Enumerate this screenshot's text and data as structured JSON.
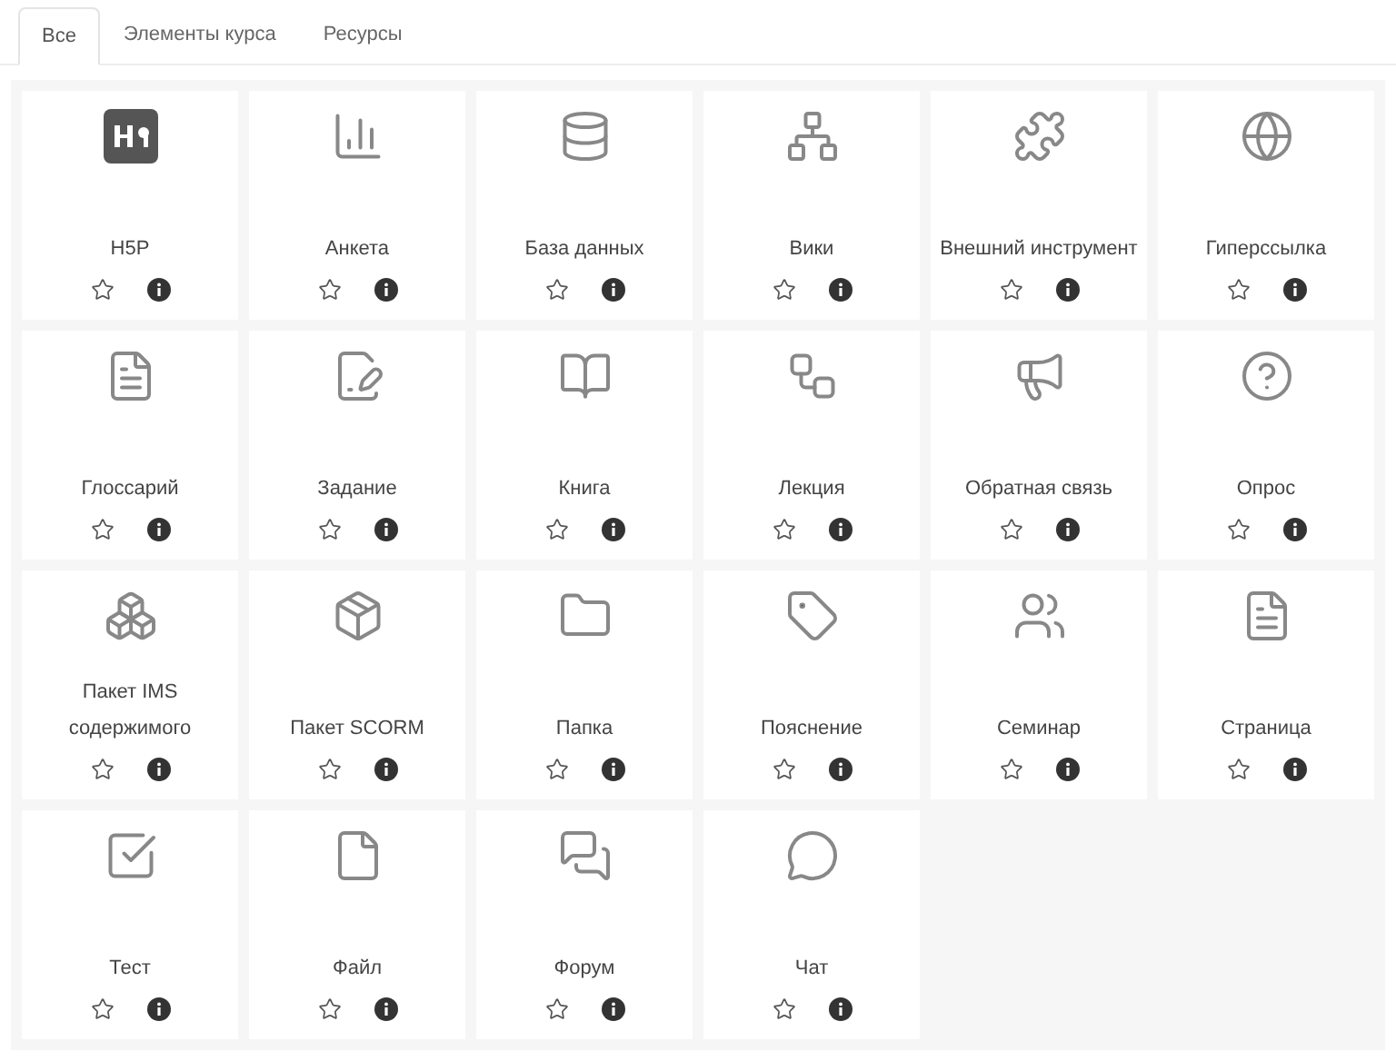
{
  "tabs": [
    {
      "label": "Все",
      "selected": true
    },
    {
      "label": "Элементы курса",
      "selected": false
    },
    {
      "label": "Ресурсы",
      "selected": false
    }
  ],
  "items": [
    {
      "label": "H5P",
      "starred": false
    },
    {
      "label": "Анкета",
      "starred": false
    },
    {
      "label": "База данных",
      "starred": false
    },
    {
      "label": "Вики",
      "starred": false
    },
    {
      "label": "Внешний инструмент",
      "starred": false
    },
    {
      "label": "Гиперссылка",
      "starred": false
    },
    {
      "label": "Глоссарий",
      "starred": false
    },
    {
      "label": "Задание",
      "starred": false
    },
    {
      "label": "Книга",
      "starred": false
    },
    {
      "label": "Лекция",
      "starred": false
    },
    {
      "label": "Обратная связь",
      "starred": false
    },
    {
      "label": "Опрос",
      "starred": false
    },
    {
      "label": "Пакет IMS содержимого",
      "starred": false
    },
    {
      "label": "Пакет SCORM",
      "starred": false
    },
    {
      "label": "Папка",
      "starred": false
    },
    {
      "label": "Пояснение",
      "starred": false
    },
    {
      "label": "Семинар",
      "starred": false
    },
    {
      "label": "Страница",
      "starred": false
    },
    {
      "label": "Тест",
      "starred": false
    },
    {
      "label": "Файл",
      "starred": false
    },
    {
      "label": "Форум",
      "starred": false
    },
    {
      "label": "Чат",
      "starred": false
    }
  ]
}
